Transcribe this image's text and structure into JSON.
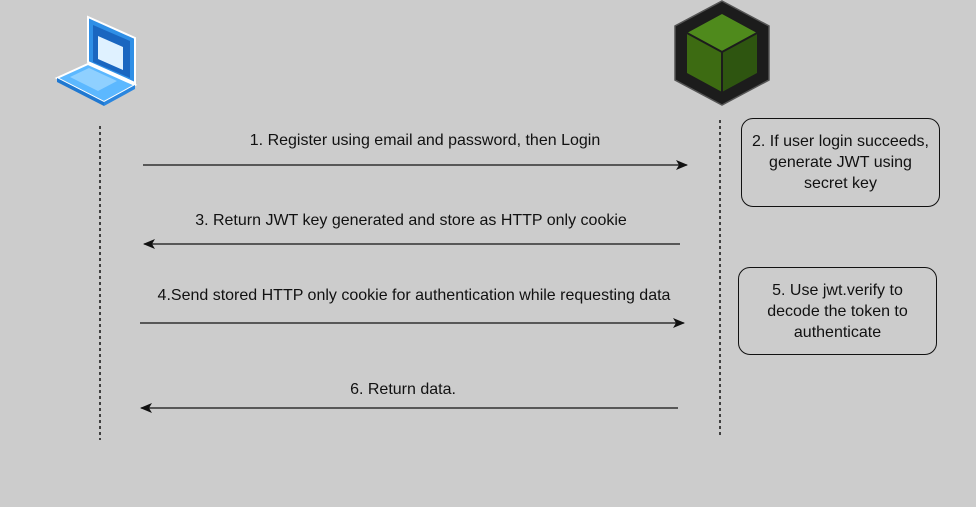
{
  "participants": [
    {
      "icon": "laptop-icon"
    },
    {
      "icon": "nodejs-cube-icon"
    }
  ],
  "messages": [
    {
      "text": "1. Register using email and password, then Login",
      "direction": "client-to-server"
    },
    {
      "text": "3. Return JWT key generated and store as HTTP only cookie",
      "direction": "server-to-client"
    },
    {
      "text": "4.Send stored HTTP only cookie for authentication while requesting data",
      "direction": "client-to-server"
    },
    {
      "text": "6. Return data.",
      "direction": "server-to-client"
    }
  ],
  "notes": [
    {
      "lines": [
        "2. If user login succeeds,",
        "generate JWT using",
        "secret key"
      ]
    },
    {
      "lines": [
        "5. Use jwt.verify to",
        "decode the token to",
        "authenticate"
      ]
    }
  ],
  "colors": {
    "background": "#cccccc",
    "line": "#111111",
    "laptop_blue": "#3a9ff5",
    "laptop_light": "#bfe3ff",
    "cube_green": "#3d6b12",
    "cube_dark": "#1c1c1c"
  }
}
